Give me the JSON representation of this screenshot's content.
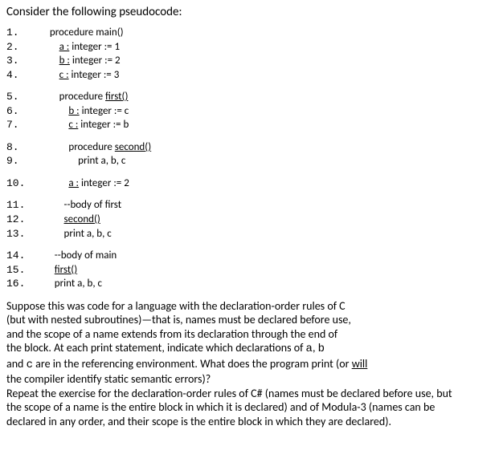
{
  "intro": "Consider the following pseudocode:",
  "code": {
    "lines": [
      {
        "n": "1.",
        "indent": "  ",
        "u": false,
        "pre": "procedure main()",
        "mono_pre": false
      },
      {
        "n": "2.",
        "indent": "      ",
        "u": true,
        "txt": "a :",
        "post": " integer := 1"
      },
      {
        "n": "3.",
        "indent": "      ",
        "u": true,
        "txt": "b :",
        "post": " integer := 2"
      },
      {
        "n": "4.",
        "indent": "      ",
        "u": true,
        "txt": "c :",
        "post": " integer := 3"
      },
      {
        "gap": true
      },
      {
        "n": "5.",
        "indent": "      ",
        "u": false,
        "pre": "procedure ",
        "u2": true,
        "txt2": "first()"
      },
      {
        "n": "6.",
        "indent": "          ",
        "u": true,
        "txt": "b :",
        "post": " integer := c"
      },
      {
        "n": "7.",
        "indent": "          ",
        "u": true,
        "txt": "c :",
        "post": " integer := b"
      },
      {
        "gap": true
      },
      {
        "n": "8.",
        "indent": "          ",
        "u": false,
        "pre": "procedure ",
        "u2": true,
        "txt2": "second()"
      },
      {
        "n": "9.",
        "indent": "              ",
        "u": false,
        "pre": "print a, b, c"
      },
      {
        "gap": true
      },
      {
        "n": "10.",
        "indent": "          ",
        "u": true,
        "txt": "a :",
        "post": " integer := 2"
      },
      {
        "gap": true
      },
      {
        "n": "11.",
        "indent": "        ",
        "u": false,
        "pre": "--body of first"
      },
      {
        "n": "12.",
        "indent": "        ",
        "u": true,
        "txt": "second()"
      },
      {
        "n": "13.",
        "indent": "        ",
        "u": false,
        "pre": "print a, b, c"
      },
      {
        "gap": true
      },
      {
        "n": "14.",
        "indent": "    ",
        "u": false,
        "pre": "--body of main"
      },
      {
        "n": "15.",
        "indent": "    ",
        "u": true,
        "txt": "first()"
      },
      {
        "n": "16.",
        "indent": "    ",
        "u": false,
        "pre": "print a, b, c"
      }
    ]
  },
  "question": {
    "p1a": "Suppose this was code for a language with the declaration-order rules of C",
    "p1b": "(but with nested subroutines)—that is, names must be declared before use,",
    "p1c": "and the scope of a name extends from its declaration through the end of",
    "p1d_pre": "the block. At each print statement, indicate which declarations of ",
    "p1d_mono1": "a",
    "p1d_mid": ", ",
    "p1d_mono2": "b",
    "p1e_pre": "and ",
    "p1e_mono": "c",
    "p1e_mid": "  are in the referencing environment. What does the program print (or ",
    "p1e_ul": "will",
    "p1f": "the compiler identify static semantic errors)?",
    "p2a": "Repeat the exercise for the declaration-order rules of C# (names must be declared before use, but",
    "p2b": "the scope of a name is the entire block in which it is declared) and of Modula-3 (names can be",
    "p2c": "declared in any order, and their scope is the entire block in which they are declared)."
  }
}
